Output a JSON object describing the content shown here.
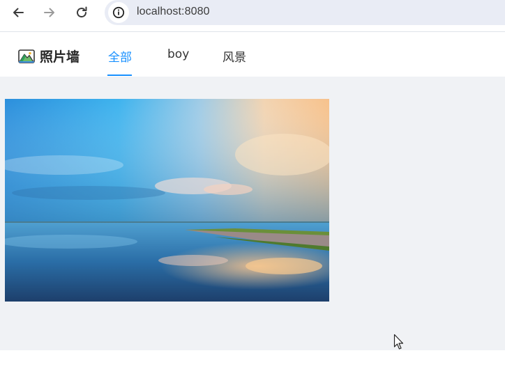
{
  "browser": {
    "url": "localhost:8080",
    "icons": {
      "back": "arrow-left-icon",
      "forward": "arrow-right-icon",
      "reload": "reload-icon",
      "site_info": "info-icon"
    }
  },
  "app": {
    "brand": "照片墙",
    "logo_icon": "mountain-photo-icon",
    "tabs": [
      {
        "label": "全部",
        "active": true
      },
      {
        "label": "boy",
        "active": false
      },
      {
        "label": "风景",
        "active": false
      }
    ],
    "accent_color": "#1890ff"
  },
  "gallery": {
    "photos": [
      {
        "subject": "lake-reflection-sunset"
      }
    ]
  }
}
